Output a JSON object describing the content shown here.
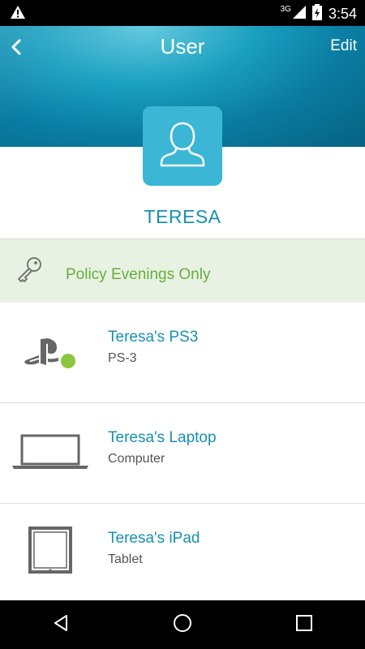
{
  "status_bar": {
    "network": "3G",
    "time": "3:54",
    "icons": [
      "warning-icon",
      "signal-icon",
      "battery-icon"
    ]
  },
  "header": {
    "title": "User",
    "edit_label": "Edit",
    "back_icon": "chevron-left-icon"
  },
  "user": {
    "name": "TERESA",
    "avatar_icon": "person-icon"
  },
  "policy": {
    "icon": "key-icon",
    "label": "Policy Evenings Only"
  },
  "devices": [
    {
      "name": "Teresa's PS3",
      "type": "PS-3",
      "icon": "playstation-icon",
      "status": "online"
    },
    {
      "name": "Teresa's Laptop",
      "type": "Computer",
      "icon": "laptop-icon"
    },
    {
      "name": "Teresa's iPad",
      "type": "Tablet",
      "icon": "tablet-icon"
    }
  ],
  "nav": {
    "icons": [
      "back-triangle-icon",
      "home-circle-icon",
      "recents-square-icon"
    ]
  },
  "colors": {
    "accent": "#1791b0",
    "policy_green": "#66ae3c",
    "policy_bg": "#e8f2e2",
    "avatar_bg": "#3bb7d5",
    "online": "#8cc63f"
  }
}
